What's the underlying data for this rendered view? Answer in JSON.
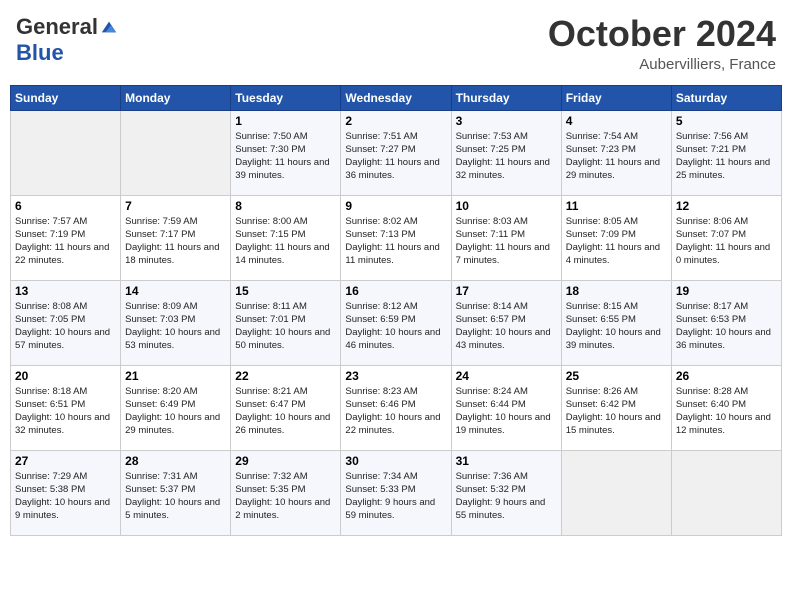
{
  "header": {
    "logo_general": "General",
    "logo_blue": "Blue",
    "month_title": "October 2024",
    "location": "Aubervilliers, France"
  },
  "weekdays": [
    "Sunday",
    "Monday",
    "Tuesday",
    "Wednesday",
    "Thursday",
    "Friday",
    "Saturday"
  ],
  "weeks": [
    [
      {
        "day": "",
        "info": ""
      },
      {
        "day": "",
        "info": ""
      },
      {
        "day": "1",
        "info": "Sunrise: 7:50 AM\nSunset: 7:30 PM\nDaylight: 11 hours and 39 minutes."
      },
      {
        "day": "2",
        "info": "Sunrise: 7:51 AM\nSunset: 7:27 PM\nDaylight: 11 hours and 36 minutes."
      },
      {
        "day": "3",
        "info": "Sunrise: 7:53 AM\nSunset: 7:25 PM\nDaylight: 11 hours and 32 minutes."
      },
      {
        "day": "4",
        "info": "Sunrise: 7:54 AM\nSunset: 7:23 PM\nDaylight: 11 hours and 29 minutes."
      },
      {
        "day": "5",
        "info": "Sunrise: 7:56 AM\nSunset: 7:21 PM\nDaylight: 11 hours and 25 minutes."
      }
    ],
    [
      {
        "day": "6",
        "info": "Sunrise: 7:57 AM\nSunset: 7:19 PM\nDaylight: 11 hours and 22 minutes."
      },
      {
        "day": "7",
        "info": "Sunrise: 7:59 AM\nSunset: 7:17 PM\nDaylight: 11 hours and 18 minutes."
      },
      {
        "day": "8",
        "info": "Sunrise: 8:00 AM\nSunset: 7:15 PM\nDaylight: 11 hours and 14 minutes."
      },
      {
        "day": "9",
        "info": "Sunrise: 8:02 AM\nSunset: 7:13 PM\nDaylight: 11 hours and 11 minutes."
      },
      {
        "day": "10",
        "info": "Sunrise: 8:03 AM\nSunset: 7:11 PM\nDaylight: 11 hours and 7 minutes."
      },
      {
        "day": "11",
        "info": "Sunrise: 8:05 AM\nSunset: 7:09 PM\nDaylight: 11 hours and 4 minutes."
      },
      {
        "day": "12",
        "info": "Sunrise: 8:06 AM\nSunset: 7:07 PM\nDaylight: 11 hours and 0 minutes."
      }
    ],
    [
      {
        "day": "13",
        "info": "Sunrise: 8:08 AM\nSunset: 7:05 PM\nDaylight: 10 hours and 57 minutes."
      },
      {
        "day": "14",
        "info": "Sunrise: 8:09 AM\nSunset: 7:03 PM\nDaylight: 10 hours and 53 minutes."
      },
      {
        "day": "15",
        "info": "Sunrise: 8:11 AM\nSunset: 7:01 PM\nDaylight: 10 hours and 50 minutes."
      },
      {
        "day": "16",
        "info": "Sunrise: 8:12 AM\nSunset: 6:59 PM\nDaylight: 10 hours and 46 minutes."
      },
      {
        "day": "17",
        "info": "Sunrise: 8:14 AM\nSunset: 6:57 PM\nDaylight: 10 hours and 43 minutes."
      },
      {
        "day": "18",
        "info": "Sunrise: 8:15 AM\nSunset: 6:55 PM\nDaylight: 10 hours and 39 minutes."
      },
      {
        "day": "19",
        "info": "Sunrise: 8:17 AM\nSunset: 6:53 PM\nDaylight: 10 hours and 36 minutes."
      }
    ],
    [
      {
        "day": "20",
        "info": "Sunrise: 8:18 AM\nSunset: 6:51 PM\nDaylight: 10 hours and 32 minutes."
      },
      {
        "day": "21",
        "info": "Sunrise: 8:20 AM\nSunset: 6:49 PM\nDaylight: 10 hours and 29 minutes."
      },
      {
        "day": "22",
        "info": "Sunrise: 8:21 AM\nSunset: 6:47 PM\nDaylight: 10 hours and 26 minutes."
      },
      {
        "day": "23",
        "info": "Sunrise: 8:23 AM\nSunset: 6:46 PM\nDaylight: 10 hours and 22 minutes."
      },
      {
        "day": "24",
        "info": "Sunrise: 8:24 AM\nSunset: 6:44 PM\nDaylight: 10 hours and 19 minutes."
      },
      {
        "day": "25",
        "info": "Sunrise: 8:26 AM\nSunset: 6:42 PM\nDaylight: 10 hours and 15 minutes."
      },
      {
        "day": "26",
        "info": "Sunrise: 8:28 AM\nSunset: 6:40 PM\nDaylight: 10 hours and 12 minutes."
      }
    ],
    [
      {
        "day": "27",
        "info": "Sunrise: 7:29 AM\nSunset: 5:38 PM\nDaylight: 10 hours and 9 minutes."
      },
      {
        "day": "28",
        "info": "Sunrise: 7:31 AM\nSunset: 5:37 PM\nDaylight: 10 hours and 5 minutes."
      },
      {
        "day": "29",
        "info": "Sunrise: 7:32 AM\nSunset: 5:35 PM\nDaylight: 10 hours and 2 minutes."
      },
      {
        "day": "30",
        "info": "Sunrise: 7:34 AM\nSunset: 5:33 PM\nDaylight: 9 hours and 59 minutes."
      },
      {
        "day": "31",
        "info": "Sunrise: 7:36 AM\nSunset: 5:32 PM\nDaylight: 9 hours and 55 minutes."
      },
      {
        "day": "",
        "info": ""
      },
      {
        "day": "",
        "info": ""
      }
    ]
  ]
}
